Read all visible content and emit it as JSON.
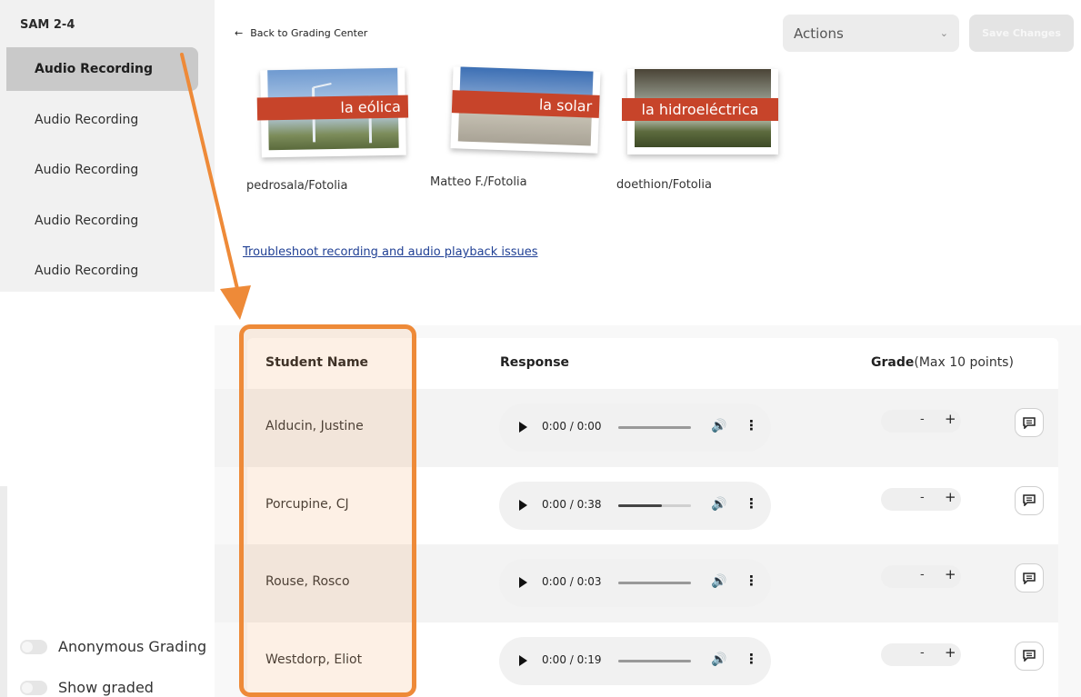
{
  "sidebar": {
    "title": "SAM 2-4",
    "items": [
      {
        "label": "Audio Recording",
        "active": true
      },
      {
        "label": "Audio Recording",
        "active": false
      },
      {
        "label": "Audio Recording",
        "active": false
      },
      {
        "label": "Audio Recording",
        "active": false
      },
      {
        "label": "Audio Recording",
        "active": false
      }
    ],
    "toggles": [
      {
        "label": "Anonymous Grading",
        "on": false
      },
      {
        "label": "Show graded",
        "on": false
      }
    ]
  },
  "header": {
    "back_arrow": "←",
    "back_label": "Back to Grading Center",
    "actions_label": "Actions",
    "actions_chevron": "⌄",
    "save_label": "Save Changes"
  },
  "images": [
    {
      "banner": "la eólica",
      "credit": "pedrosala/Fotolia"
    },
    {
      "banner": "la solar",
      "credit": "Matteo F./Fotolia"
    },
    {
      "banner": "la hidroeléctrica",
      "credit": "doethion/Fotolia"
    }
  ],
  "troubleshoot_link": "Troubleshoot recording and audio playback issues",
  "table": {
    "col_name": "Student Name",
    "col_response": "Response",
    "col_grade": "Grade",
    "col_grade_note": "(Max 10 points)",
    "rows": [
      {
        "name": "Alducin, Justine",
        "time": "0:00 / 0:00",
        "progress": 0
      },
      {
        "name": "Porcupine, CJ",
        "time": "0:00 / 0:38",
        "progress": 0.6
      },
      {
        "name": "Rouse, Rosco",
        "time": "0:00 / 0:03",
        "progress": 0
      },
      {
        "name": "Westdorp, Eliot",
        "time": "0:00 / 0:19",
        "progress": 0
      }
    ],
    "minus_symbol": "-",
    "plus_symbol": "+",
    "volume_icon": "🔊",
    "more_icon": "⋮"
  },
  "colors": {
    "highlight": "#ee8a38",
    "banner": "#c7442a",
    "link": "#1f3f94"
  }
}
